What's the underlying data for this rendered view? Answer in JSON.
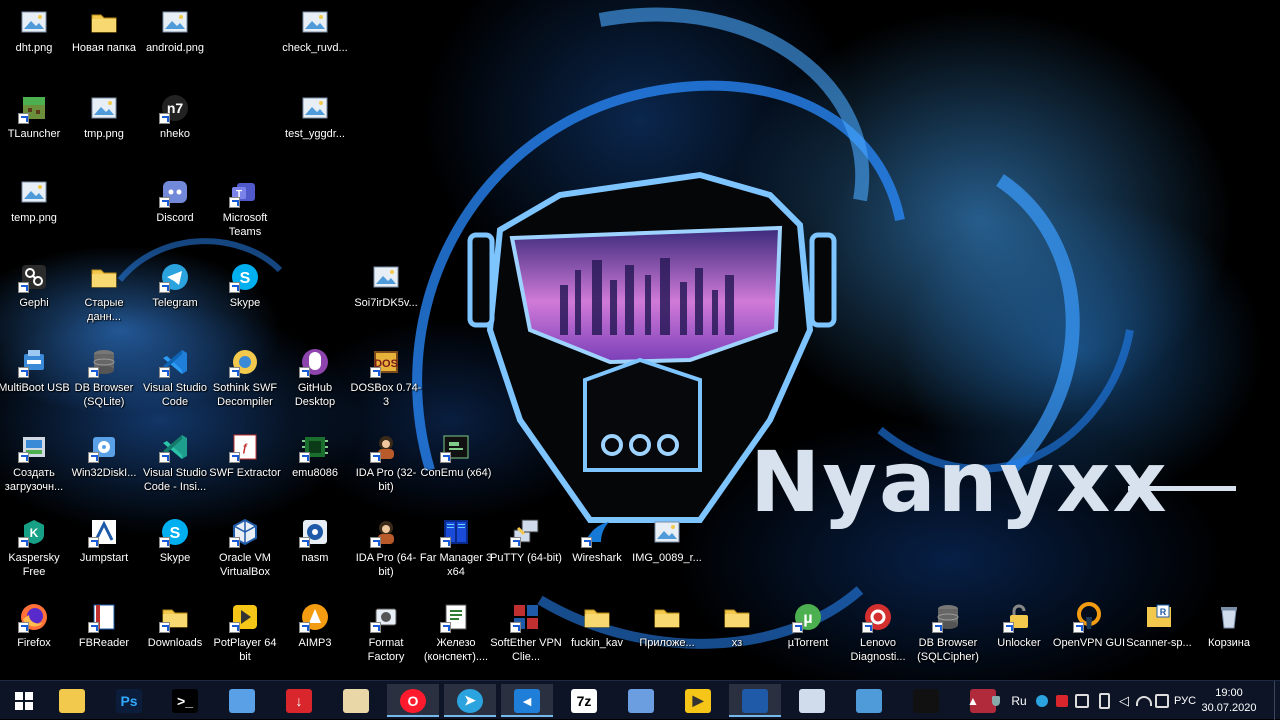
{
  "wallpaper": {
    "watermark": "Nyanyxx"
  },
  "desktop": {
    "icons": [
      {
        "label": "dht.png",
        "icon": "image-icon",
        "shortcut": false
      },
      {
        "label": "Новая папка",
        "icon": "folder-icon",
        "shortcut": false
      },
      {
        "label": "android.png",
        "icon": "image-icon",
        "shortcut": false
      },
      {
        "label": "check_ruvd...",
        "icon": "image-icon",
        "shortcut": false
      },
      {
        "label": "TLauncher",
        "icon": "minecraft-icon",
        "shortcut": true
      },
      {
        "label": "tmp.png",
        "icon": "image-icon",
        "shortcut": false
      },
      {
        "label": "nheko",
        "icon": "nheko-icon",
        "shortcut": true
      },
      {
        "label": "test_yggdr...",
        "icon": "image-icon",
        "shortcut": false
      },
      {
        "label": "temp.png",
        "icon": "image-icon",
        "shortcut": false
      },
      {
        "label": "Discord",
        "icon": "discord-icon",
        "shortcut": true
      },
      {
        "label": "Microsoft Teams",
        "icon": "teams-icon",
        "shortcut": true
      },
      {
        "label": "Gephi",
        "icon": "gephi-icon",
        "shortcut": true
      },
      {
        "label": "Старые данн...",
        "icon": "folder-icon",
        "shortcut": false
      },
      {
        "label": "Telegram",
        "icon": "telegram-icon",
        "shortcut": true
      },
      {
        "label": "Skype",
        "icon": "skype-icon",
        "shortcut": true
      },
      {
        "label": "Soi7irDK5v...",
        "icon": "image-icon",
        "shortcut": false
      },
      {
        "label": "MultiBoot USB",
        "icon": "multiboot-icon",
        "shortcut": true
      },
      {
        "label": "DB Browser (SQLite)",
        "icon": "database-icon",
        "shortcut": true
      },
      {
        "label": "Visual Studio Code",
        "icon": "vscode-icon",
        "shortcut": true
      },
      {
        "label": "Sothink SWF Decompiler",
        "icon": "sothink-icon",
        "shortcut": true
      },
      {
        "label": "GitHub Desktop",
        "icon": "github-desktop-icon",
        "shortcut": true
      },
      {
        "label": "DOSBox 0.74-3",
        "icon": "dosbox-icon",
        "shortcut": true
      },
      {
        "label": "Создать загрузочн...",
        "icon": "installer-icon",
        "shortcut": true
      },
      {
        "label": "Win32DiskI...",
        "icon": "win32disk-icon",
        "shortcut": true
      },
      {
        "label": "Visual Studio Code - Insi...",
        "icon": "vscode-insiders-icon",
        "shortcut": true
      },
      {
        "label": "SWF Extractor",
        "icon": "swf-extractor-icon",
        "shortcut": true
      },
      {
        "label": "emu8086",
        "icon": "chip-icon",
        "shortcut": true
      },
      {
        "label": "IDA Pro (32-bit)",
        "icon": "ida-icon",
        "shortcut": true
      },
      {
        "label": "ConEmu (x64)",
        "icon": "conemu-icon",
        "shortcut": true
      },
      {
        "label": "Kaspersky Free",
        "icon": "kaspersky-icon",
        "shortcut": true
      },
      {
        "label": "Jumpstart",
        "icon": "jumpstart-icon",
        "shortcut": true
      },
      {
        "label": "Skype",
        "icon": "skype-icon",
        "shortcut": true
      },
      {
        "label": "Oracle VM VirtualBox",
        "icon": "virtualbox-icon",
        "shortcut": true
      },
      {
        "label": "nasm",
        "icon": "nasm-icon",
        "shortcut": true
      },
      {
        "label": "IDA Pro (64-bit)",
        "icon": "ida-icon",
        "shortcut": true
      },
      {
        "label": "Far Manager 3 x64",
        "icon": "far-manager-icon",
        "shortcut": true
      },
      {
        "label": "PuTTY (64-bit)",
        "icon": "putty-icon",
        "shortcut": true
      },
      {
        "label": "Wireshark",
        "icon": "wireshark-icon",
        "shortcut": true
      },
      {
        "label": "IMG_0089_r...",
        "icon": "image-icon",
        "shortcut": false
      },
      {
        "label": "Firefox",
        "icon": "firefox-icon",
        "shortcut": true
      },
      {
        "label": "FBReader",
        "icon": "fbreader-icon",
        "shortcut": true
      },
      {
        "label": "Downloads",
        "icon": "folder-icon",
        "shortcut": true
      },
      {
        "label": "PotPlayer 64 bit",
        "icon": "potplayer-icon",
        "shortcut": true
      },
      {
        "label": "AIMP3",
        "icon": "aimp-icon",
        "shortcut": true
      },
      {
        "label": "Format Factory",
        "icon": "format-factory-icon",
        "shortcut": true
      },
      {
        "label": "Железо (конспект)....",
        "icon": "document-icon",
        "shortcut": true
      },
      {
        "label": "SoftEther VPN Clie...",
        "icon": "softether-icon",
        "shortcut": true
      },
      {
        "label": "fuckin_kav",
        "icon": "folder-icon",
        "shortcut": false
      },
      {
        "label": "Приложе...",
        "icon": "folder-icon",
        "shortcut": false
      },
      {
        "label": "хз",
        "icon": "folder-icon",
        "shortcut": false
      },
      {
        "label": "µTorrent",
        "icon": "utorrent-icon",
        "shortcut": true
      },
      {
        "label": "Lenovo Diagnosti...",
        "icon": "lenovo-diagnostics-icon",
        "shortcut": true
      },
      {
        "label": "DB Browser (SQLCipher)",
        "icon": "database-icon",
        "shortcut": true
      },
      {
        "label": "Unlocker",
        "icon": "unlocker-icon",
        "shortcut": true
      },
      {
        "label": "OpenVPN GUI",
        "icon": "openvpn-icon",
        "shortcut": true
      },
      {
        "label": "Scanner-sp...",
        "icon": "scanner-icon",
        "shortcut": false
      },
      {
        "label": "Корзина",
        "icon": "recycle-bin-icon",
        "shortcut": false
      }
    ]
  },
  "taskbar": {
    "start": {
      "icon": "windows-logo-icon"
    },
    "apps": [
      {
        "name": "file-explorer",
        "icon": "folder-icon",
        "glyph": "",
        "bg": "#f2c94c",
        "fg": "#7a5a10",
        "active": false
      },
      {
        "name": "photoshop",
        "icon": "photoshop-icon",
        "glyph": "Ps",
        "bg": "#0b1d3a",
        "fg": "#31a8ff",
        "active": false
      },
      {
        "name": "terminal",
        "icon": "terminal-icon",
        "glyph": ">_",
        "bg": "#000000",
        "fg": "#ffffff",
        "active": false
      },
      {
        "name": "remote-desktop",
        "icon": "remote-desktop-icon",
        "glyph": "",
        "bg": "#5aa0e6",
        "fg": "#ffffff",
        "active": false
      },
      {
        "name": "downloader",
        "icon": "download-icon",
        "glyph": "↓",
        "bg": "#d9262c",
        "fg": "#ffffff",
        "active": false
      },
      {
        "name": "paint",
        "icon": "paint-palette-icon",
        "glyph": "",
        "bg": "#e9d7a8",
        "fg": "#c03030",
        "active": false
      },
      {
        "name": "opera",
        "icon": "opera-icon",
        "glyph": "O",
        "bg": "#ff1b2d",
        "fg": "#ffffff",
        "active": true
      },
      {
        "name": "telegram",
        "icon": "telegram-icon",
        "glyph": "➤",
        "bg": "#2aa3df",
        "fg": "#ffffff",
        "active": true
      },
      {
        "name": "vscode",
        "icon": "vscode-icon",
        "glyph": "◄",
        "bg": "#1f7fd8",
        "fg": "#ffffff",
        "active": true
      },
      {
        "name": "7zip",
        "icon": "7zip-icon",
        "glyph": "7z",
        "bg": "#ffffff",
        "fg": "#000000",
        "active": false
      },
      {
        "name": "putty",
        "icon": "putty-icon",
        "glyph": "",
        "bg": "#6a9ee0",
        "fg": "#ffffff",
        "active": false
      },
      {
        "name": "potplayer",
        "icon": "potplayer-icon",
        "glyph": "▶",
        "bg": "#f5c518",
        "fg": "#333333",
        "active": false
      },
      {
        "name": "virtualbox",
        "icon": "virtualbox-icon",
        "glyph": "",
        "bg": "#1e5aa8",
        "fg": "#ffffff",
        "active": true
      },
      {
        "name": "resource-monitor",
        "icon": "monitor-icon",
        "glyph": "",
        "bg": "#d0dcec",
        "fg": "#1e5aa8",
        "active": false
      },
      {
        "name": "photos",
        "icon": "image-viewer-icon",
        "glyph": "",
        "bg": "#4f9bd9",
        "fg": "#ffffff",
        "active": false
      },
      {
        "name": "screenshot-tool",
        "icon": "capture-icon",
        "glyph": "",
        "bg": "#111111",
        "fg": "#ffffff",
        "active": false
      },
      {
        "name": "app-64",
        "icon": "app-64-icon",
        "glyph": "",
        "bg": "#b02a3c",
        "fg": "#ffffff",
        "active": false
      }
    ],
    "tray": {
      "chevron": "▲",
      "language_short": "Ru",
      "language": "РУС",
      "time": "19:00",
      "date": "30.07.2020"
    }
  }
}
